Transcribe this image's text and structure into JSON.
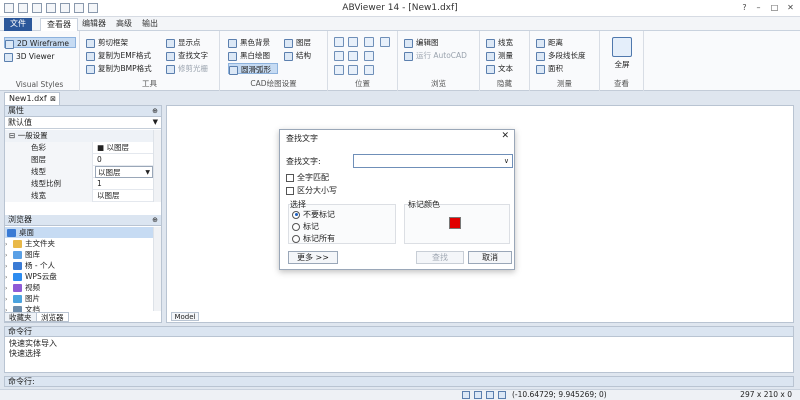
{
  "window": {
    "title": "ABViewer 14 - [New1.dxf]",
    "controls": [
      "?",
      "–",
      "□",
      "✕"
    ]
  },
  "menu": {
    "tabs": [
      "文件",
      "查看器",
      "编辑器",
      "高级",
      "输出"
    ]
  },
  "ribbon": {
    "visual_styles": {
      "label": "Visual Styles",
      "items": [
        "2D Wireframe",
        "3D Viewer"
      ]
    },
    "tools": {
      "label": "工具",
      "col1": [
        "剪切框架",
        "复制为EMF格式",
        "复制为BMP格式"
      ],
      "col2": [
        "显示点",
        "查找文字",
        "修剪光栅"
      ]
    },
    "cad_settings": {
      "label": "CAD绘图设置",
      "col1": [
        "黑色背景",
        "黑白绘图",
        "圆滑弧形"
      ],
      "col2": [
        "图层",
        "结构"
      ]
    },
    "position": {
      "label": "位置"
    },
    "browse": {
      "label": "浏览",
      "items": [
        "编辑图",
        "运行 AutoCAD"
      ]
    },
    "hide": {
      "label": "隐藏",
      "items": [
        "线宽",
        "测量",
        "文本"
      ]
    },
    "measure": {
      "label": "测量",
      "items": [
        "距离",
        "多段线长度",
        "面积"
      ]
    },
    "view": {
      "label": "查看",
      "button": "全屏"
    }
  },
  "document": {
    "tab": "New1.dxf"
  },
  "properties": {
    "header": "属性",
    "pin": "⊕",
    "selector": "默认值",
    "section": "一般设置",
    "rows": [
      {
        "key": "色彩",
        "value": "■ 以图层"
      },
      {
        "key": "图层",
        "value": "0"
      },
      {
        "key": "线型",
        "value": "以图层"
      },
      {
        "key": "线型比例",
        "value": "1"
      },
      {
        "key": "线宽",
        "value": "以图层"
      }
    ]
  },
  "browser": {
    "header": "浏览器",
    "root": "桌面",
    "items": [
      "主文件夹",
      "图库",
      "杨 - 个人",
      "WPS云盘",
      "视频",
      "图片",
      "文档"
    ],
    "tabs": [
      "收藏夹",
      "浏览器"
    ]
  },
  "canvas": {
    "model_tab": "Model"
  },
  "find_dialog": {
    "title": "查找文字",
    "close": "✕",
    "find_label": "查找文字:",
    "find_value": "",
    "options": [
      "全字匹配",
      "区分大小写"
    ],
    "select_label": "选择",
    "radios": [
      "不要标记",
      "标记",
      "标记所有"
    ],
    "selected_radio": "不要标记",
    "mark_color_label": "标记颜色",
    "mark_color": "#e00000",
    "more_button": "更多 >>",
    "find_button": "查找",
    "cancel_button": "取消"
  },
  "command": {
    "header": "命令行",
    "log": [
      "快速实体导入",
      "快速选择"
    ],
    "prompt": "命令行:"
  },
  "status": {
    "coords": "(-10.64729; 9.945269; 0)",
    "size": "297 x 210 x 0"
  },
  "colors": {
    "accent": "#2b579a",
    "panel_header": "#dbe5f1",
    "selection": "#c6dbf3"
  }
}
